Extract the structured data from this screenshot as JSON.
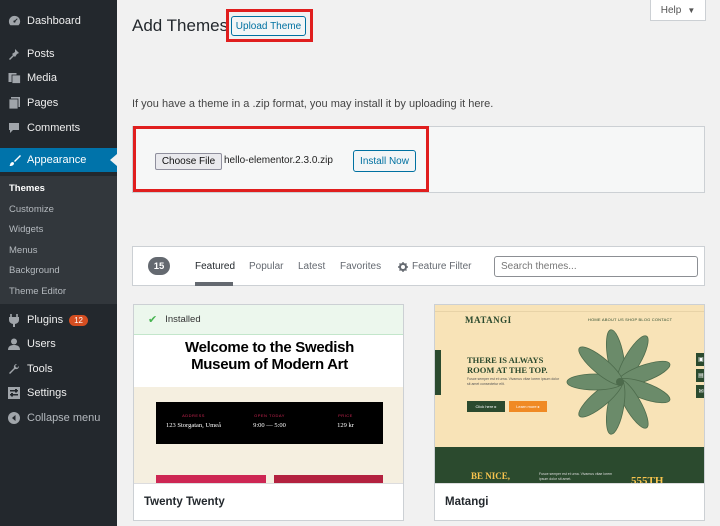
{
  "sidebar": {
    "items": [
      {
        "label": "Dashboard",
        "icon": "dashboard-icon"
      },
      {
        "label": "Posts",
        "icon": "pin-icon"
      },
      {
        "label": "Media",
        "icon": "media-icon"
      },
      {
        "label": "Pages",
        "icon": "pages-icon"
      },
      {
        "label": "Comments",
        "icon": "comment-icon"
      },
      {
        "label": "Appearance",
        "icon": "brush-icon"
      },
      {
        "label": "Plugins",
        "icon": "plug-icon",
        "badge": "12"
      },
      {
        "label": "Users",
        "icon": "user-icon"
      },
      {
        "label": "Tools",
        "icon": "wrench-icon"
      },
      {
        "label": "Settings",
        "icon": "settings-icon"
      },
      {
        "label": "Collapse menu",
        "icon": "collapse-icon"
      }
    ],
    "submenu": [
      "Themes",
      "Customize",
      "Widgets",
      "Menus",
      "Background",
      "Theme Editor"
    ]
  },
  "help": {
    "label": "Help"
  },
  "header": {
    "title": "Add Themes",
    "upload_label": "Upload Theme"
  },
  "upload": {
    "intro": "If you have a theme in a .zip format, you may install it by uploading it here.",
    "choose_label": "Choose File",
    "file_name": "hello-elementor.2.3.0.zip",
    "install_label": "Install Now"
  },
  "filter": {
    "count": "15",
    "tabs": [
      "Featured",
      "Popular",
      "Latest",
      "Favorites"
    ],
    "feature_filter": "Feature Filter",
    "search_placeholder": "Search themes..."
  },
  "themes": [
    {
      "name": "Twenty Twenty",
      "installed_label": "Installed",
      "preview_heading_1": "Welcome to the Swedish",
      "preview_heading_2": "Museum of Modern Art",
      "preview_cols": [
        {
          "label": "ADDRESS",
          "value": "123 Storgatan, Umeå"
        },
        {
          "label": "OPEN TODAY",
          "value": "9:00 — 5:00"
        },
        {
          "label": "PRICE",
          "value": "129 kr"
        }
      ]
    },
    {
      "name": "Matangi",
      "preview_logo": "MATANGI",
      "preview_nav": "HOME  ABOUT US  SHOP  BLOG  CONTACT",
      "preview_headline_1": "THERE IS ALWAYS",
      "preview_headline_2": "ROOM AT THE TOP.",
      "preview_sub": "Fusce semper est et urna. Vivamus vitae lorem ipsum dolor sit amet consectetur elit.",
      "preview_btn1": "Click here ▸",
      "preview_btn2": "Learn more ▸",
      "preview_bottom_title_1": "BE NICE,",
      "preview_bottom_price": "555TH",
      "preview_bottom_text": "Fusce semper est et urna. Vivamus vitae lorem ipsum dolor sit amet."
    }
  ],
  "colors": {
    "sidebar": "#23282d",
    "accent": "#0073aa",
    "highlight": "#e01e1e",
    "badge": "#d54e21"
  }
}
